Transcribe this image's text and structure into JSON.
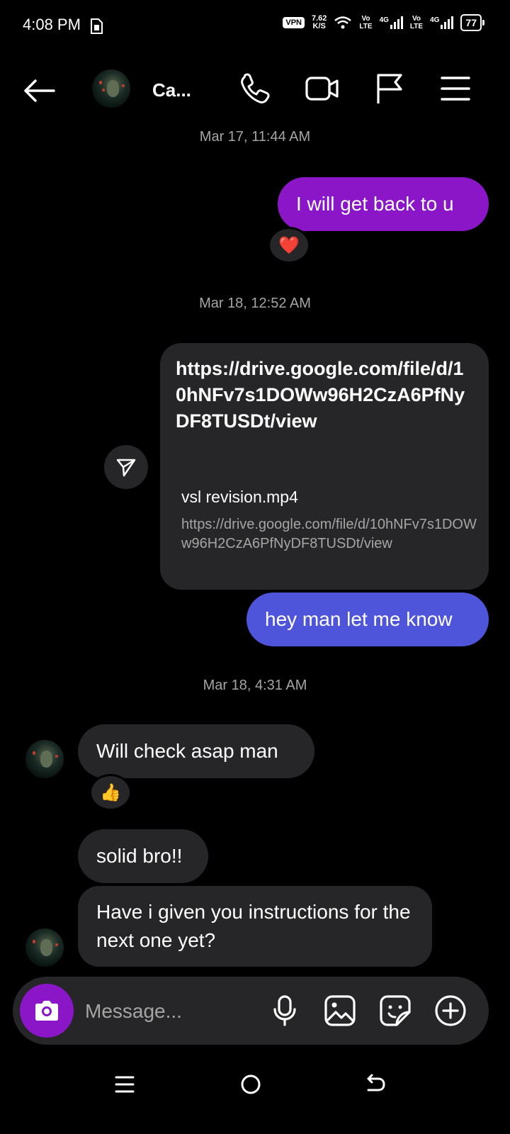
{
  "status_bar": {
    "time": "4:08 PM",
    "vpn": "VPN",
    "speed_value": "7.62",
    "speed_unit": "K/S",
    "sim1_top": "Vo",
    "sim1_bottom": "LTE",
    "sim1_net": "4G",
    "sim2_top": "Vo",
    "sim2_bottom": "LTE",
    "sim2_net": "4G",
    "battery": "77"
  },
  "header": {
    "contact_name": "Ca...",
    "icons": [
      "back-arrow-icon",
      "phone-icon",
      "video-icon",
      "flag-icon",
      "menu-icon"
    ]
  },
  "conversation": {
    "stamp1": "Mar 17, 11:44 AM",
    "msg1": "I will get back to u",
    "msg1_reaction": "❤️",
    "stamp2": "Mar 18, 12:52 AM",
    "link_text": "https://drive.google.com/file/d/10hNFv7s1DOWw96H2CzA6PfNyDF8TUSDt/view",
    "link_title": "vsl revision.mp4",
    "link_url": "https://drive.google.com/file/d/10hNFv7s1DOWw96H2CzA6PfNyDF8TUSDt/view",
    "msg2": "hey man let me know",
    "stamp3": "Mar 18, 4:31 AM",
    "msg3": "Will check asap man",
    "msg3_reaction": "👍",
    "msg4": "solid bro!!",
    "msg5": "Have i given you instructions for the next one yet?"
  },
  "composer": {
    "placeholder": "Message...",
    "icons": [
      "camera-icon",
      "microphone-icon",
      "gallery-icon",
      "sticker-icon",
      "plus-icon"
    ]
  },
  "colors": {
    "sent_purple": "#8a16c7",
    "sent_blue": "#4f55db",
    "received": "#262628",
    "background": "#000000"
  }
}
